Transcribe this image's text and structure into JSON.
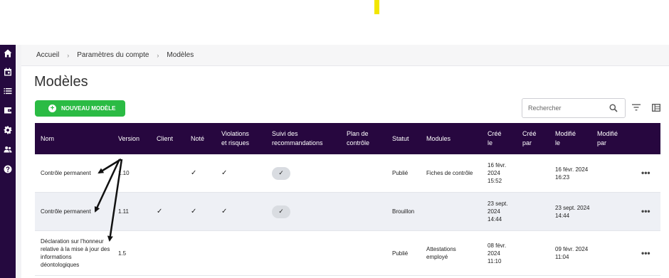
{
  "sidebar": {
    "icons": [
      "home-icon",
      "calendar-icon",
      "list-icon",
      "wallet-icon",
      "gear-icon",
      "users-icon",
      "help-icon"
    ]
  },
  "breadcrumb": {
    "items": [
      "Accueil",
      "Paramètres du compte",
      "Modèles"
    ],
    "separator": "›"
  },
  "page": {
    "title": "Modèles",
    "new_button": "NOUVEAU MODÈLE",
    "search_placeholder": "Rechercher"
  },
  "table": {
    "headers": {
      "nom": "Nom",
      "version": "Version",
      "client": "Client",
      "note": "Noté",
      "violations_1": "Violations",
      "violations_2": "et risques",
      "suivi_1": "Suivi des",
      "suivi_2": "recommandations",
      "plan_1": "Plan de",
      "plan_2": "contrôle",
      "statut": "Statut",
      "modules": "Modules",
      "cree_1": "Créé",
      "cree_2": "le",
      "creepar_1": "Créé",
      "creepar_2": "par",
      "modifie_1": "Modifié",
      "modifie_2": "le",
      "modifiepar_1": "Modifié",
      "modifiepar_2": "par"
    },
    "rows": [
      {
        "nom_lines": [
          "Contrôle permanent"
        ],
        "version": "1.10",
        "client": false,
        "note": true,
        "violations": true,
        "suivi": true,
        "statut": "Publié",
        "modules": [
          "Fiches de contrôle"
        ],
        "cree_le": [
          "16 févr.",
          "2024",
          "15:52"
        ],
        "modifie_le": [
          "16 févr. 2024",
          "16:23"
        ]
      },
      {
        "nom_lines": [
          "Contrôle permanent"
        ],
        "version": "1.11",
        "client": true,
        "note": true,
        "violations": true,
        "suivi": true,
        "statut": "Brouillon",
        "modules": [],
        "cree_le": [
          "23 sept.",
          "2024",
          "14:44"
        ],
        "modifie_le": [
          "23 sept. 2024",
          "14:44"
        ]
      },
      {
        "nom_lines": [
          "Déclaration sur l'honneur",
          "relative à la mise à jour des",
          "informations",
          "déontologiques"
        ],
        "version": "1.5",
        "client": false,
        "note": false,
        "violations": false,
        "suivi": false,
        "statut": "Publié",
        "modules": [
          "Attestations",
          "employé"
        ],
        "cree_le": [
          "08 févr.",
          "2024",
          "11:10"
        ],
        "modifie_le": [
          "09 févr. 2024",
          "11:04"
        ]
      }
    ],
    "check_glyph": "✓",
    "more_glyph": "•••"
  },
  "colors": {
    "sidebar": "#25093f",
    "table_header": "#27073f",
    "primary_button": "#2bbb44",
    "alt_row": "#eef0f5",
    "annotation": "#111111"
  }
}
